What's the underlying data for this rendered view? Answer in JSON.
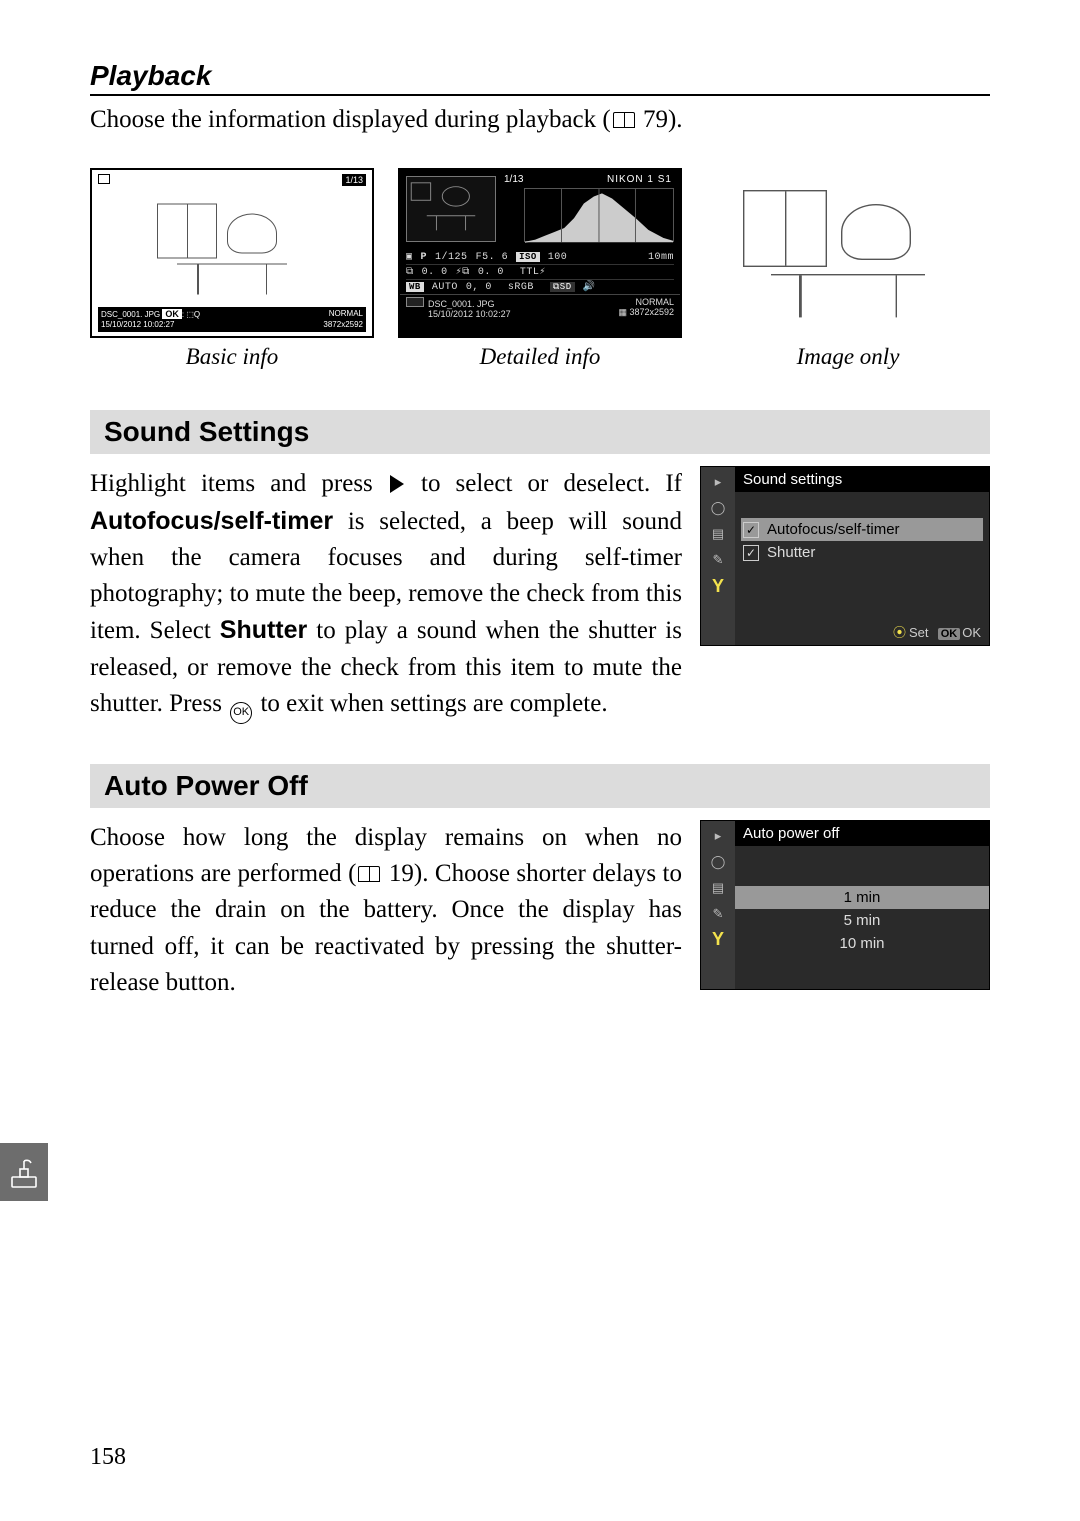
{
  "page_number": "158",
  "playback": {
    "heading": "Playback",
    "intro_pre": "Choose the information displayed during playback (",
    "intro_ref": "79",
    "intro_post": ").",
    "thumbs": {
      "basic": {
        "caption": "Basic info",
        "counter": "1/13",
        "file_line": "DSC_0001. JPG",
        "ok_badge": "OK",
        "date_line": "15/10/2012  10:02:27",
        "quality": "NORMAL",
        "dims": "3872x2592"
      },
      "detailed": {
        "caption": "Detailed info",
        "counter": "1/13",
        "model": "NIKON 1 S1",
        "row1_mode": "P",
        "row1_shutter": "1/125",
        "row1_fnum": "F5. 6",
        "row1_iso_label": "ISO",
        "row1_iso": "100",
        "row1_focal": "10mm",
        "row2_ev": "0. 0",
        "row2_flashcomp": "0. 0",
        "row2_flash": "TTL",
        "row3_wb_label": "WB",
        "row3_wb": "AUTO",
        "row3_wbadj": "0, 0",
        "row3_cs": "sRGB",
        "row3_pc": "SD",
        "bottom_file": "DSC_0001. JPG",
        "bottom_date": "15/10/2012  10:02:27",
        "bottom_quality": "NORMAL",
        "bottom_dims": "3872x2592"
      },
      "image_only": {
        "caption": "Image only"
      }
    }
  },
  "sound_settings": {
    "heading": "Sound Settings",
    "p1_a": "Highlight items and press ",
    "p1_b": " to select or deselect. If ",
    "p1_bold1": "Autofocus/self-timer",
    "p1_c": " is selected, a beep will sound when the camera focuses and during self-timer photography; to mute the beep, remove the check from this item. Select ",
    "p1_bold2": "Shutter",
    "p1_d": " to play a sound when the shutter is released, or remove the check from this item to mute the shutter. Press ",
    "p1_e": " to exit when settings are complete.",
    "menu": {
      "header": "Sound settings",
      "items": [
        {
          "label": "Autofocus/self-timer",
          "checked": true,
          "selected": true
        },
        {
          "label": "Shutter",
          "checked": true,
          "selected": false
        }
      ],
      "foot_set": "Set",
      "foot_ok": "OK"
    }
  },
  "auto_power_off": {
    "heading": "Auto Power Off",
    "p_a": "Choose how long the display remains on when no operations are performed (",
    "p_ref": "19",
    "p_b": "). Choose shorter delays to reduce the drain on the battery. Once the display has turned off, it can be reactivated by pressing the shutter-release button.",
    "menu": {
      "header": "Auto power off",
      "items": [
        "1 min",
        "5 min",
        "10 min"
      ],
      "selected_index": 0
    }
  }
}
